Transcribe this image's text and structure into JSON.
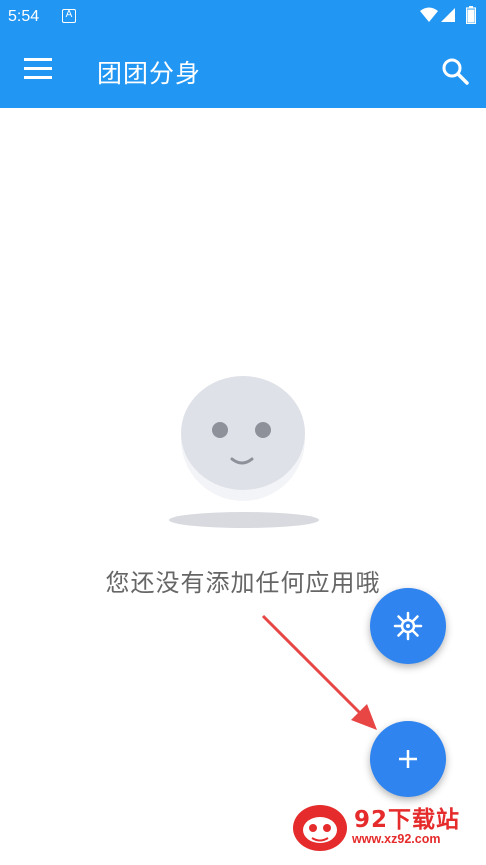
{
  "status_bar": {
    "time": "5:54",
    "notification_icon": "A",
    "icons": [
      "wifi-icon",
      "signal-icon",
      "battery-icon"
    ]
  },
  "app_bar": {
    "title": "团团分身",
    "left_icon": "menu-icon",
    "right_icon": "search-icon",
    "color": "#2196f3"
  },
  "empty_state": {
    "message": "您还没有添加任何应用哦",
    "illustration": "smiley-face"
  },
  "fabs": {
    "settings_icon": "virus-settings-icon",
    "add_icon": "plus-icon",
    "color": "#2f84f0"
  },
  "watermark": {
    "brand": "92下载站",
    "url": "www.xz92.com",
    "color": "#e52b2b"
  }
}
